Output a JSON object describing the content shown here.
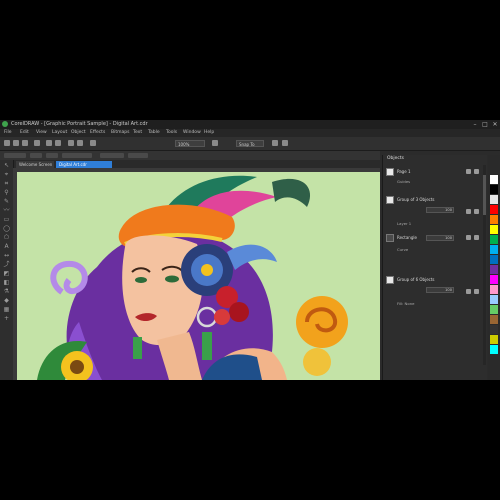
{
  "window": {
    "title": "CorelDRAW - [Graphic Portrait Sample] - Digital Art.cdr",
    "controls": [
      "–",
      "□",
      "✕"
    ]
  },
  "menu": [
    "File",
    "Edit",
    "View",
    "Layout",
    "Object",
    "Effects",
    "Bitmaps",
    "Text",
    "Table",
    "Tools",
    "Window",
    "Help"
  ],
  "toolbar": {
    "zoom": "100%",
    "snap": "Snap To"
  },
  "tabs": [
    {
      "label": "Welcome Screen",
      "active": false
    },
    {
      "label": "Digital Art.cdr",
      "active": true
    }
  ],
  "objects_panel": {
    "title": "Objects",
    "layers": [
      {
        "label": "Page 1",
        "value": "",
        "sub": "Guides"
      },
      {
        "label": "Group of 3 Objects",
        "value": "100",
        "sub": "Layer 1"
      },
      {
        "label": "Rectangle",
        "value": "100",
        "sub": "Curve"
      },
      {
        "label": "Group of 6 Objects",
        "value": "100",
        "sub": "Fill: None"
      }
    ]
  },
  "palette_colors": [
    "#ffffff",
    "#000000",
    "#e6e6e6",
    "#ff0000",
    "#ff7f00",
    "#ffff00",
    "#00b050",
    "#00b0f0",
    "#0070c0",
    "#7030a0",
    "#ff00ff",
    "#ff99cc",
    "#99ccff",
    "#66cc66",
    "#996633",
    "#333333",
    "#cccc00",
    "#00ffff"
  ],
  "colors": {
    "canvas_bg": "#c4e3a7",
    "accent": "#2f7ed8"
  }
}
